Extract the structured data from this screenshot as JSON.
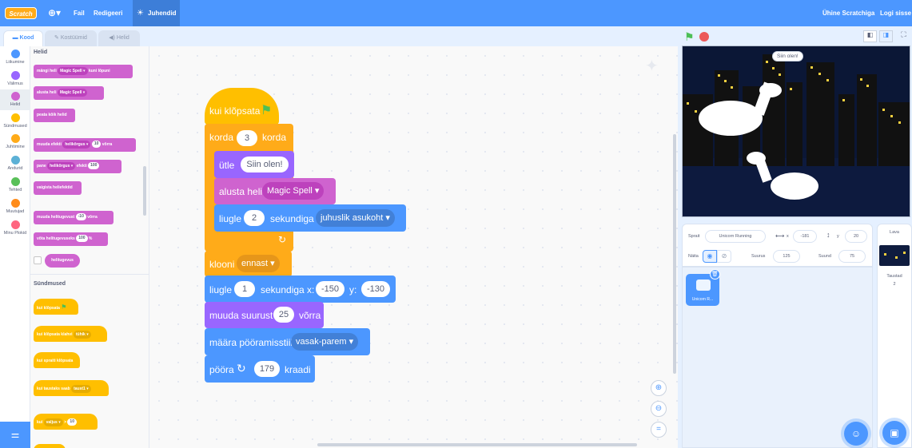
{
  "colors": {
    "motion": "#4c97ff",
    "looks": "#9966ff",
    "sound": "#cf63cf",
    "events": "#ffbf00",
    "control": "#ffab19",
    "sensing": "#5cb1d6",
    "operators": "#59c059",
    "variables": "#ff8c1a",
    "myblocks": "#ff6680",
    "menubar": "#4c97ff"
  },
  "menubar": {
    "logo": "Scratch",
    "file": "Fail",
    "edit": "Redigeeri",
    "tutorials": "Juhendid",
    "join": "Ühine Scratchiga",
    "signin": "Logi sisse"
  },
  "tabs": {
    "code": "Kood",
    "costumes": "Kostüümid",
    "sounds": "Helid"
  },
  "categories": [
    {
      "label": "Liikumine",
      "icon": "motion-dot"
    },
    {
      "label": "Välimus",
      "icon": "looks-dot"
    },
    {
      "label": "Helid",
      "icon": "sound-dot"
    },
    {
      "label": "Sündmused",
      "icon": "events-dot"
    },
    {
      "label": "Juhtimine",
      "icon": "control-dot"
    },
    {
      "label": "Andurid",
      "icon": "sensing-dot"
    },
    {
      "label": "Tehted",
      "icon": "operators-dot"
    },
    {
      "label": "Muutujad",
      "icon": "variables-dot"
    },
    {
      "label": "Minu Plokid",
      "icon": "myblocks-dot"
    }
  ],
  "palette": {
    "sound_title": "Helid",
    "play_until": {
      "a": "mängi heli",
      "menu": "Magic Spell",
      "b": "kuni lõpuni"
    },
    "start_sound": {
      "a": "alusta heli",
      "menu": "Magic Spell"
    },
    "stop_sounds": "peata kõik helid",
    "change_effect": {
      "a": "muuda efekti",
      "menu": "helikõrgus",
      "val": "10",
      "b": "võrra"
    },
    "set_effect": {
      "a": "pane",
      "menu": "helikõrgus",
      "b": "efekti",
      "val": "100"
    },
    "clear_effects": "vaigista heliefektid",
    "change_volume": {
      "a": "muuda helitugevust",
      "val": "-10",
      "b": "võrra"
    },
    "set_volume": {
      "a": "võta helitugevuseks",
      "val": "100",
      "b": "%"
    },
    "volume_reporter": "helitugevus",
    "events_title": "Sündmused",
    "when_flag": "kui klõpsata",
    "when_key": {
      "a": "kui klõpsata klahvi",
      "menu": "tühik"
    },
    "when_sprite": "kui spraiti klõpsata",
    "when_backdrop": {
      "a": "kui taustaks saab",
      "menu": "taust1"
    },
    "when_gt": {
      "a": "kui",
      "menu": "valjus",
      "op": ">",
      "val": "10"
    }
  },
  "script": {
    "hat": "kui klõpsata",
    "repeat": {
      "a": "korda",
      "val": "3",
      "b": "korda"
    },
    "say": {
      "a": "ütle",
      "val": "Siin olen!"
    },
    "start_sound": {
      "a": "alusta heli",
      "menu": "Magic Spell"
    },
    "glide_random": {
      "a": "liugle",
      "val": "2",
      "b": "sekundiga",
      "menu": "juhuslik asukoht"
    },
    "clone": {
      "a": "klooni",
      "menu": "ennast"
    },
    "glide_xy": {
      "a": "liugle",
      "secs": "1",
      "b": "sekundiga x:",
      "x": "-150",
      "c": "y:",
      "y": "-130"
    },
    "change_size": {
      "a": "muuda suurust",
      "val": "25",
      "b": "võrra"
    },
    "rotation": {
      "a": "määra pööramisstiil",
      "menu": "vasak-parem"
    },
    "turn": {
      "a": "pööra",
      "val": "179",
      "b": "kraadi"
    }
  },
  "stage": {
    "speech": "Siin olen!"
  },
  "sprite_info": {
    "sprite_label": "Sprait",
    "sprite_name": "Unicorn Running",
    "x_label": "x",
    "x": "-181",
    "y_label": "y",
    "y": "20",
    "show_label": "Näita",
    "size_label": "Suurus",
    "size": "125",
    "direction_label": "Suund",
    "direction": "75"
  },
  "sprite_list": [
    {
      "name": "Unicorn R..."
    }
  ],
  "stage_pane": {
    "title": "Lava",
    "backdrops_label": "Taustad",
    "backdrops_count": "2"
  }
}
